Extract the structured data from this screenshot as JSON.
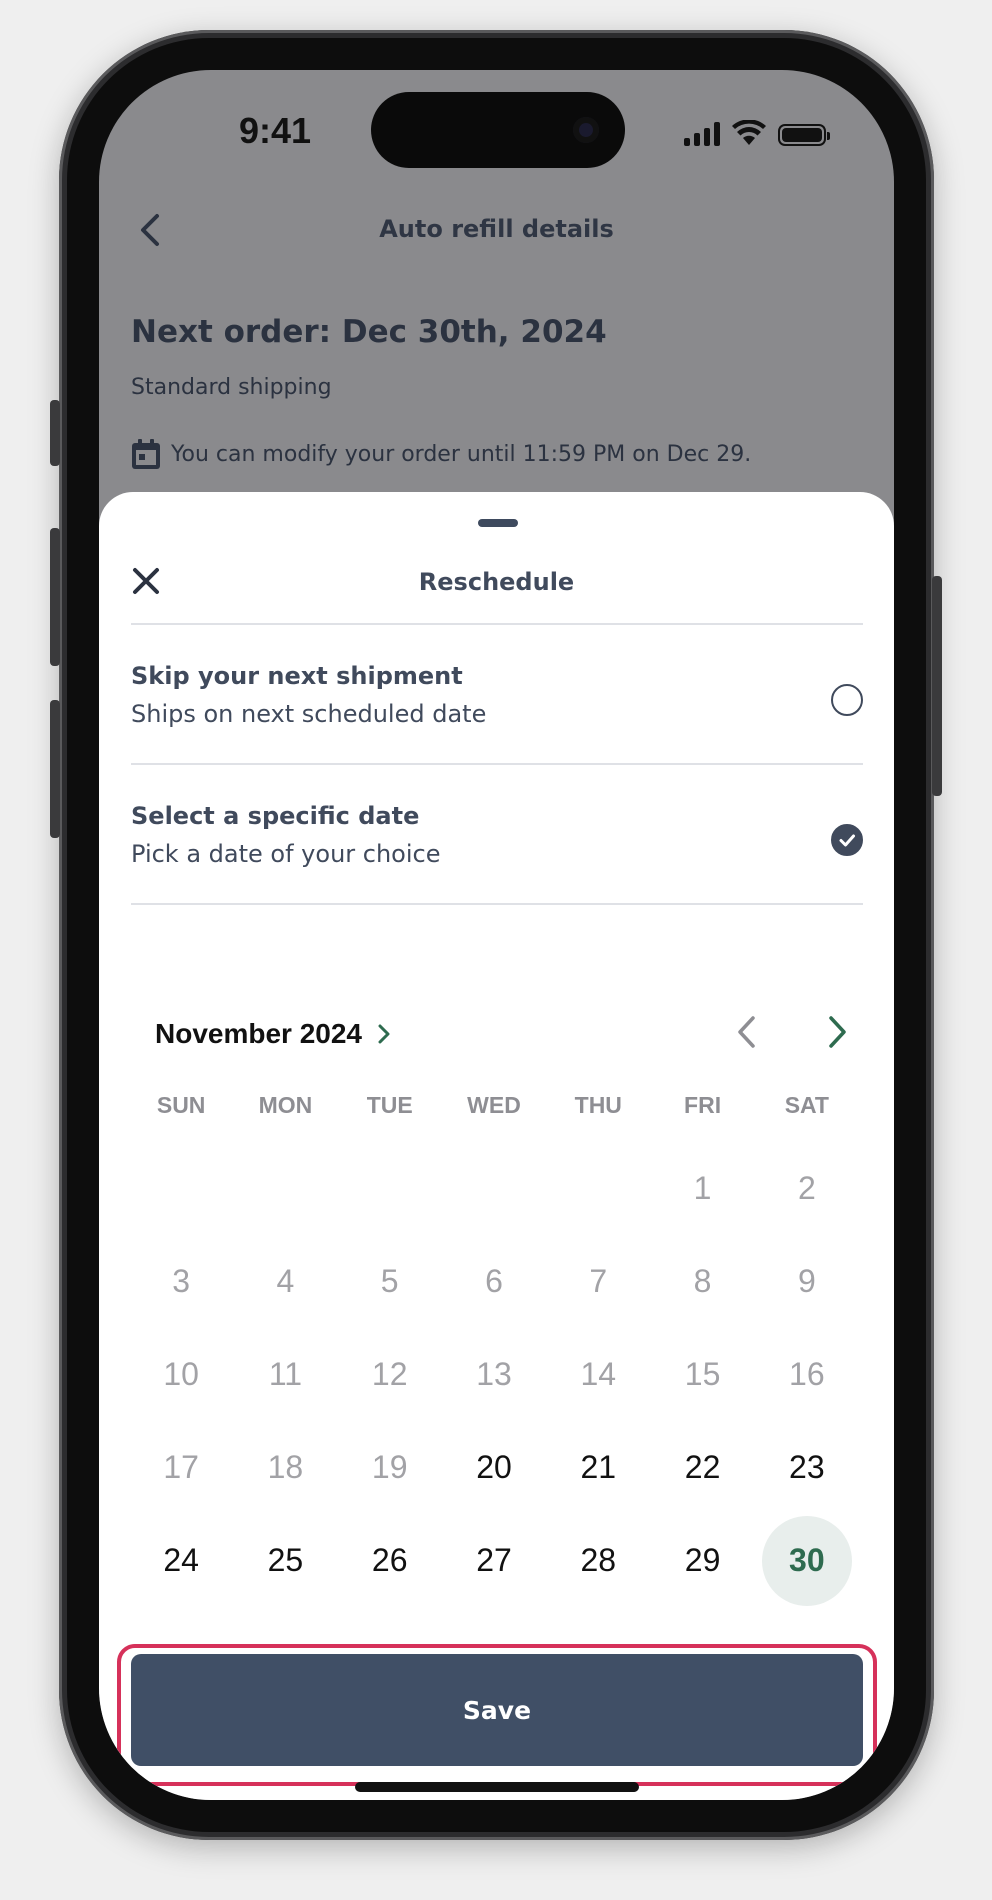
{
  "status_bar": {
    "time": "9:41"
  },
  "background_page": {
    "header_title": "Auto refill details",
    "order_title": "Next order: Dec 30th, 2024",
    "shipping": "Standard shipping",
    "modify_notice": "You can modify your order until 11:59 PM on Dec 29."
  },
  "sheet": {
    "title": "Reschedule",
    "options": [
      {
        "title": "Skip your next shipment",
        "subtitle": "Ships on next scheduled date",
        "selected": false
      },
      {
        "title": "Select a specific date",
        "subtitle": "Pick a date of your choice",
        "selected": true
      }
    ],
    "calendar": {
      "month_label": "November 2024",
      "weekdays": [
        "SUN",
        "MON",
        "TUE",
        "WED",
        "THU",
        "FRI",
        "SAT"
      ],
      "selected_day": "30",
      "accent_color": "#2e6b4f"
    },
    "save_label": "Save"
  },
  "colors": {
    "primary_button": "#404f66",
    "highlight_border": "#d6315a",
    "dimmed_overlay": "#8a8a8d"
  }
}
